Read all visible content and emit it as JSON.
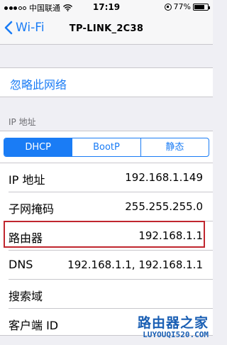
{
  "status_bar": {
    "carrier": "中国联通",
    "time": "17:19",
    "battery": "77%",
    "battery_level": 0.77,
    "signal_full_dots": 3,
    "signal_total_dots": 5
  },
  "nav": {
    "back_label": "Wi-Fi",
    "title": "TP-LINK_2C38"
  },
  "forget_network_label": "忽略此网络",
  "section_header": "IP 地址",
  "segmented": {
    "options": [
      "DHCP",
      "BootP",
      "静态"
    ],
    "selected": "DHCP"
  },
  "rows": [
    {
      "label": "IP 地址",
      "value": "192.168.1.149"
    },
    {
      "label": "子网掩码",
      "value": "255.255.255.0"
    },
    {
      "label": "路由器",
      "value": "192.168.1.1"
    },
    {
      "label": "DNS",
      "value": "192.168.1.1, 192.168.1.1"
    },
    {
      "label": "搜索域",
      "value": ""
    },
    {
      "label": "客户端 ID",
      "value": ""
    }
  ],
  "watermark": {
    "title": "路由器之家",
    "url": "LUYOUQI520.COM"
  },
  "colors": {
    "accent": "#1a7cf5",
    "highlight": "#c0262e",
    "background": "#efeff4"
  }
}
